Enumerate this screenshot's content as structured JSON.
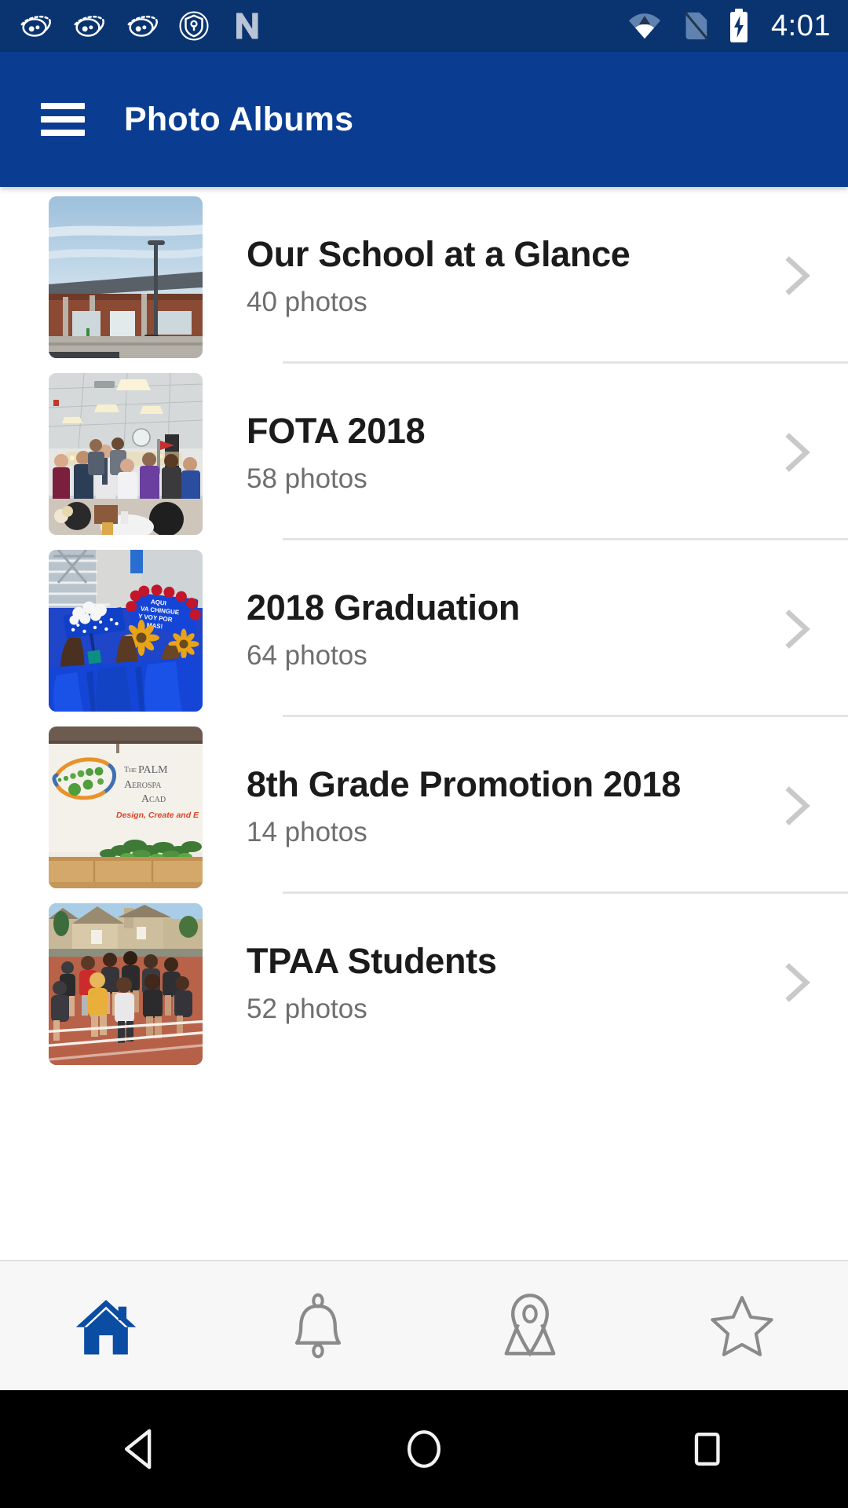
{
  "statusbar": {
    "time": "4:01",
    "left_icons": [
      {
        "name": "planet-notification-icon"
      },
      {
        "name": "planet-notification-icon"
      },
      {
        "name": "planet-notification-icon"
      },
      {
        "name": "shield-key-vpn-icon"
      },
      {
        "name": "nextdoor-n-logo-icon"
      }
    ],
    "right_icons": [
      {
        "name": "wifi-icon"
      },
      {
        "name": "no-sim-card-icon"
      },
      {
        "name": "battery-charging-icon"
      }
    ],
    "background_color": "#0a3470"
  },
  "appbar": {
    "menu_icon": "hamburger-menu-icon",
    "title": "Photo Albums",
    "background_color": "#0a3d91",
    "text_color": "#ffffff"
  },
  "albums": [
    {
      "title": "Our School at a Glance",
      "photo_count": "40 photos",
      "thumbnail": "school-building-exterior",
      "chevron": "chevron-right-icon"
    },
    {
      "title": "FOTA 2018",
      "photo_count": "58 photos",
      "thumbnail": "banquet-hall-group-photo",
      "chevron": "chevron-right-icon"
    },
    {
      "title": "2018 Graduation",
      "photo_count": "64 photos",
      "thumbnail": "decorated-graduation-caps",
      "chevron": "chevron-right-icon"
    },
    {
      "title": "8th Grade Promotion 2018",
      "photo_count": "14 photos",
      "thumbnail": "palmdale-aerospace-academy-banner",
      "chevron": "chevron-right-icon"
    },
    {
      "title": "TPAA Students",
      "photo_count": "52 photos",
      "thumbnail": "students-running-on-track",
      "chevron": "chevron-right-icon"
    }
  ],
  "tabbar": {
    "active_color": "#0a4da2",
    "inactive_color": "#8a8a8a",
    "tabs": [
      {
        "name": "home-tab",
        "icon": "home-icon",
        "active": true
      },
      {
        "name": "notifications-tab",
        "icon": "bell-icon",
        "active": false
      },
      {
        "name": "map-tab",
        "icon": "map-pin-icon",
        "active": false
      },
      {
        "name": "favorites-tab",
        "icon": "star-icon",
        "active": false
      }
    ]
  },
  "navbar": {
    "background_color": "#000000",
    "buttons": [
      {
        "name": "android-back-button",
        "icon": "triangle-back-icon"
      },
      {
        "name": "android-home-button",
        "icon": "circle-home-icon"
      },
      {
        "name": "android-recents-button",
        "icon": "square-recents-icon"
      }
    ]
  }
}
